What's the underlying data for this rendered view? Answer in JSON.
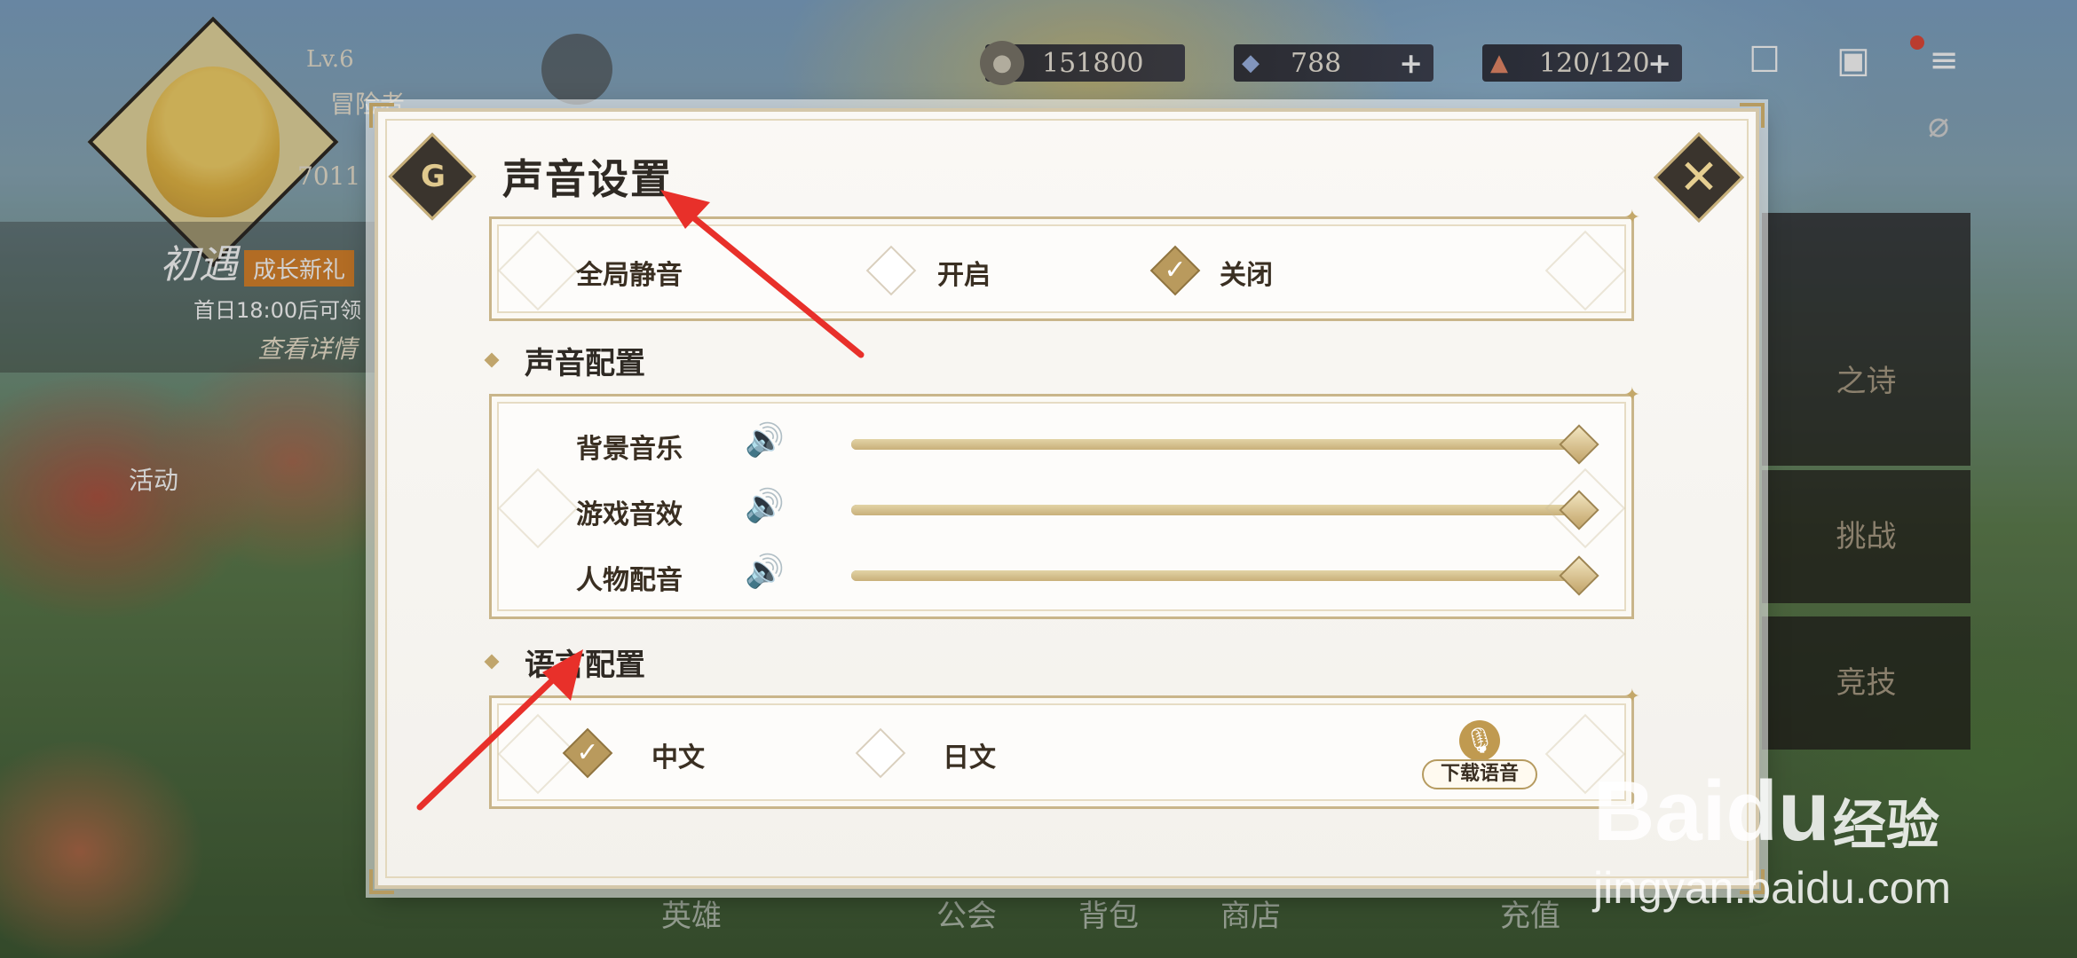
{
  "hud": {
    "level": "Lv.6",
    "rank": "冒险者",
    "power": "7011",
    "coins": "151800",
    "gems": "788",
    "stamina": "120/120",
    "plus": "+"
  },
  "side": {
    "event_title": "初遇",
    "event_tag": "成长新礼",
    "event_time": "首日18:00后可领",
    "event_detail": "查看详情",
    "activity_label": "活动"
  },
  "right_cards": [
    "之诗",
    "挑战",
    "竞技"
  ],
  "bottom_nav": [
    "英雄",
    "公会",
    "背包",
    "商店",
    "充值"
  ],
  "dialog": {
    "title": "声音设置",
    "global_mute": {
      "label": "全局静音",
      "options": [
        {
          "label": "开启",
          "checked": false
        },
        {
          "label": "关闭",
          "checked": true
        }
      ]
    },
    "sound_section": {
      "title": "声音配置",
      "sliders": [
        {
          "label": "背景音乐",
          "value": 1.0
        },
        {
          "label": "游戏音效",
          "value": 1.0
        },
        {
          "label": "人物配音",
          "value": 1.0
        }
      ]
    },
    "language_section": {
      "title": "语言配置",
      "options": [
        {
          "label": "中文",
          "checked": true
        },
        {
          "label": "日文",
          "checked": false
        }
      ],
      "download_label": "下载语音"
    }
  },
  "icons": {
    "speaker": "speaker-icon",
    "mic": "microphone-icon",
    "close": "close-icon",
    "emblem": "settings-emblem-icon"
  },
  "colors": {
    "accent_gold": "#b99a5d",
    "arrow_red": "#e8302a",
    "dialog_bg": "#faf8f5"
  },
  "watermark": {
    "brand": "Baidu",
    "cn": "经验",
    "url": "jingyan.baidu.com"
  }
}
